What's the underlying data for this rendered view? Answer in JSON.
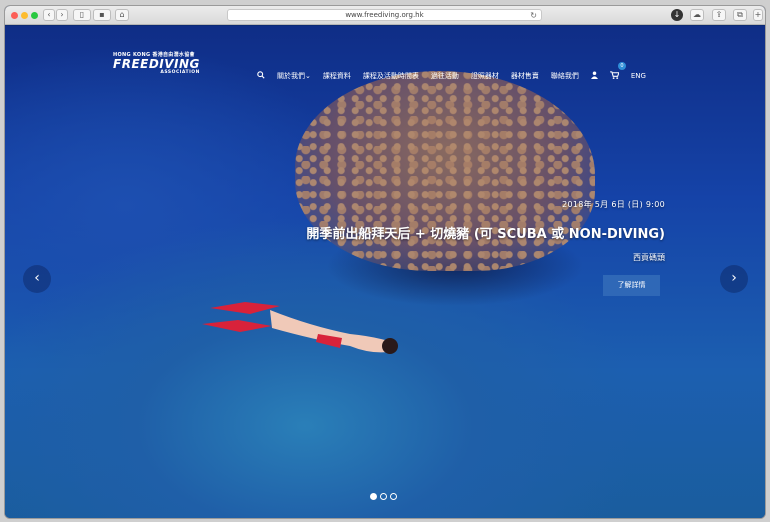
{
  "browser": {
    "url": "www.freediving.org.hk",
    "reload_icon": "reload-icon",
    "buttons": [
      "back-icon",
      "forward-icon",
      "sidebar-icon",
      "reader-icon",
      "home-icon",
      "download-icon",
      "cloud-icon",
      "share-icon",
      "tabs-icon",
      "new-tab-icon"
    ]
  },
  "logo": {
    "line1": "HONG KONG 香港自由潛水協會",
    "line2": "FREEDIVING",
    "line3": "ASSOCIATION"
  },
  "nav": {
    "items": [
      {
        "label": "關於我們",
        "icon": "chevron-down-icon"
      },
      {
        "label": "課程資料"
      },
      {
        "label": "課程及活動時間表"
      },
      {
        "label": "過往活動"
      },
      {
        "label": "證照器材"
      },
      {
        "label": "器材售賣"
      },
      {
        "label": "聯絡我們"
      }
    ],
    "cart_count": "0",
    "language": "ENG",
    "icons": [
      "search-icon",
      "user-icon",
      "cart-icon"
    ]
  },
  "slide": {
    "date": "2018年 5月 6日 (日) 9:00",
    "title": "開季前出船拜天后 + 切燒豬 (可 SCUBA 或 NON-DIVING)",
    "location": "西貢碼頭",
    "button": "了解詳情",
    "prev_label": "‹",
    "next_label": "›",
    "active_index": 1,
    "count": 3
  },
  "colors": {
    "accent_button": "#2f68b7",
    "badge": "#2f8fd8"
  }
}
